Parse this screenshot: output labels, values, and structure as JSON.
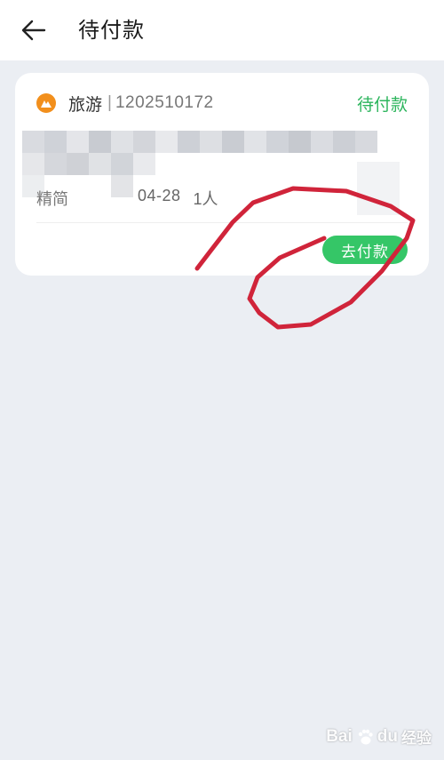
{
  "header": {
    "title": "待付款"
  },
  "order": {
    "type_label": "旅游",
    "separator": "|",
    "order_number": "1202510172",
    "status": "待付款",
    "info_prefix": "精简",
    "date": "04-28",
    "people": "1人",
    "pay_button": "去付款"
  },
  "watermark": {
    "brand": "Bai",
    "brand_du": "du",
    "suffix": "经验"
  },
  "colors": {
    "accent_green": "#2db55d",
    "button_green": "#35c667",
    "type_icon": "#f28f1c",
    "annotation_red": "#d0243a",
    "background": "#ebeef3"
  },
  "icons": {
    "back": "arrow-left-icon",
    "type": "travel-icon",
    "watermark": "baidu-paw-icon"
  }
}
